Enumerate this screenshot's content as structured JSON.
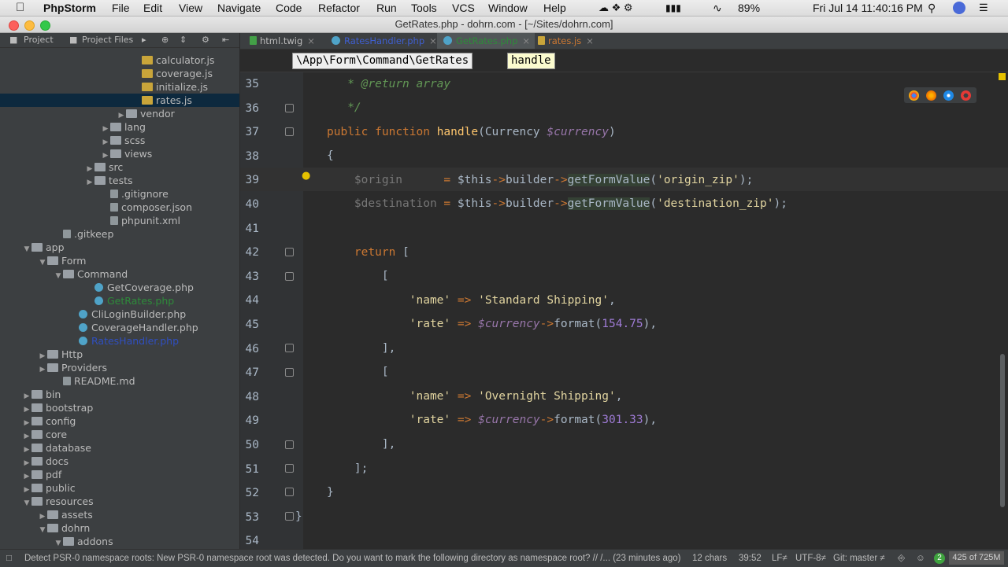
{
  "menubar": {
    "app": "PhpStorm",
    "items": [
      "File",
      "Edit",
      "View",
      "Navigate",
      "Code",
      "Refactor",
      "Run",
      "Tools",
      "VCS",
      "Window",
      "Help"
    ],
    "battery": "89%",
    "clock": "Fri Jul 14  11:40:16 PM"
  },
  "window": {
    "title": "GetRates.php - dohrn.com - [~/Sites/dohrn.com]"
  },
  "sidebar": {
    "tabs": [
      "Project",
      "Project Files"
    ],
    "tree": [
      {
        "label": "calculator.js",
        "depth": 9,
        "icon": "js",
        "arrow": ""
      },
      {
        "label": "coverage.js",
        "depth": 9,
        "icon": "js",
        "arrow": ""
      },
      {
        "label": "initialize.js",
        "depth": 9,
        "icon": "js",
        "arrow": ""
      },
      {
        "label": "rates.js",
        "depth": 9,
        "icon": "js",
        "arrow": "",
        "selected": true
      },
      {
        "label": "vendor",
        "depth": 8,
        "icon": "folder",
        "arrow": "▶"
      },
      {
        "label": "lang",
        "depth": 7,
        "icon": "folder",
        "arrow": "▶"
      },
      {
        "label": "scss",
        "depth": 7,
        "icon": "folder",
        "arrow": "▶"
      },
      {
        "label": "views",
        "depth": 7,
        "icon": "folder",
        "arrow": "▶"
      },
      {
        "label": "src",
        "depth": 6,
        "icon": "folder",
        "arrow": "▶"
      },
      {
        "label": "tests",
        "depth": 6,
        "icon": "folder",
        "arrow": "▶"
      },
      {
        "label": ".gitignore",
        "depth": 7,
        "icon": "file",
        "arrow": ""
      },
      {
        "label": "composer.json",
        "depth": 7,
        "icon": "file",
        "arrow": ""
      },
      {
        "label": "phpunit.xml",
        "depth": 7,
        "icon": "file",
        "arrow": ""
      },
      {
        "label": ".gitkeep",
        "depth": 4,
        "icon": "file",
        "arrow": ""
      },
      {
        "label": "app",
        "depth": 2,
        "icon": "folder",
        "arrow": "▼"
      },
      {
        "label": "Form",
        "depth": 3,
        "icon": "folder",
        "arrow": "▼"
      },
      {
        "label": "Command",
        "depth": 4,
        "icon": "folder",
        "arrow": "▼"
      },
      {
        "label": "GetCoverage.php",
        "depth": 6,
        "icon": "php",
        "arrow": ""
      },
      {
        "label": "GetRates.php",
        "depth": 6,
        "icon": "php",
        "arrow": "",
        "color": "#2e8b3a"
      },
      {
        "label": "CliLoginBuilder.php",
        "depth": 5,
        "icon": "php",
        "arrow": ""
      },
      {
        "label": "CoverageHandler.php",
        "depth": 5,
        "icon": "php",
        "arrow": ""
      },
      {
        "label": "RatesHandler.php",
        "depth": 5,
        "icon": "php",
        "arrow": "",
        "color": "#2f4fc0"
      },
      {
        "label": "Http",
        "depth": 3,
        "icon": "folder",
        "arrow": "▶"
      },
      {
        "label": "Providers",
        "depth": 3,
        "icon": "folder",
        "arrow": "▶"
      },
      {
        "label": "README.md",
        "depth": 4,
        "icon": "file",
        "arrow": ""
      },
      {
        "label": "bin",
        "depth": 2,
        "icon": "folder",
        "arrow": "▶"
      },
      {
        "label": "bootstrap",
        "depth": 2,
        "icon": "folder",
        "arrow": "▶"
      },
      {
        "label": "config",
        "depth": 2,
        "icon": "folder",
        "arrow": "▶"
      },
      {
        "label": "core",
        "depth": 2,
        "icon": "folder",
        "arrow": "▶"
      },
      {
        "label": "database",
        "depth": 2,
        "icon": "folder",
        "arrow": "▶"
      },
      {
        "label": "docs",
        "depth": 2,
        "icon": "folder",
        "arrow": "▶"
      },
      {
        "label": "pdf",
        "depth": 2,
        "icon": "folder",
        "arrow": "▶"
      },
      {
        "label": "public",
        "depth": 2,
        "icon": "folder",
        "arrow": "▶"
      },
      {
        "label": "resources",
        "depth": 2,
        "icon": "folder",
        "arrow": "▼"
      },
      {
        "label": "assets",
        "depth": 3,
        "icon": "folder",
        "arrow": "▶"
      },
      {
        "label": "dohrn",
        "depth": 3,
        "icon": "folder",
        "arrow": "▼"
      },
      {
        "label": "addons",
        "depth": 4,
        "icon": "folder",
        "arrow": "▼"
      }
    ]
  },
  "editor": {
    "tabs": [
      {
        "label": "html.twig",
        "color": "#bbbbbb",
        "icon_color": "#43a047"
      },
      {
        "label": "RatesHandler.php",
        "color": "#3f5fd0",
        "icon_color": "#4fa3c8"
      },
      {
        "label": "GetRates.php",
        "color": "#2e8b3a",
        "icon_color": "#4fa3c8",
        "active": true
      },
      {
        "label": "rates.js",
        "color": "#cc7832",
        "icon_color": "#c9a53a"
      }
    ],
    "breadcrumbs": [
      "\\App\\Form\\Command\\GetRates",
      "handle"
    ],
    "line_numbers": [
      "35",
      "36",
      "37",
      "38",
      "39",
      "40",
      "41",
      "42",
      "43",
      "44",
      "45",
      "46",
      "47",
      "48",
      "49",
      "50",
      "51",
      "52",
      "53",
      "54"
    ],
    "tokens": {
      "return_doc": " * @return array",
      "close_doc": " */",
      "public": "public",
      "function": "function",
      "handle": "handle",
      "currency_type": "(Currency ",
      "currency_var": "$currency",
      "close_paren": ")",
      "open_brace": "{",
      "origin_var": "$origin",
      "destination_var": "$destination",
      "assign": "=",
      "this": "$this",
      "arrow": "->",
      "builder": "builder",
      "getFormValue": "getFormValue",
      "origin_arg": "'origin_zip'",
      "destination_arg": "'destination_zip'",
      "call_end": ");",
      "open_paren": "(",
      "return": "return",
      "open_bracket": "[",
      "name_key": "'name'",
      "rate_key": "'rate'",
      "fat_arrow": "=>",
      "standard": "'Standard Shipping'",
      "overnight": "'Overnight Shipping'",
      "comma": ",",
      "format": "format",
      "num1": "154.75",
      "num2": "301.33",
      "close_bracket_comma": "],",
      "close_bracket_semi": "];",
      "close_brace": "}"
    }
  },
  "statusbar": {
    "message": "Detect PSR-0 namespace roots: New PSR-0 namespace root was detected. Do you want to mark the following directory as namespace root? // /... (23 minutes ago)",
    "chars": "12 chars",
    "position": "39:52",
    "line_sep": "LF≠",
    "encoding": "UTF-8≠",
    "git": "Git: master ≠",
    "memory": "425 of 725M",
    "badge": "2"
  },
  "colors": {
    "background": "#2b2b2b",
    "keyword": "#cc7832",
    "function": "#ffc66d",
    "variable": "#9876aa",
    "string": "#e2d5a0",
    "number": "#9f7bd6"
  }
}
